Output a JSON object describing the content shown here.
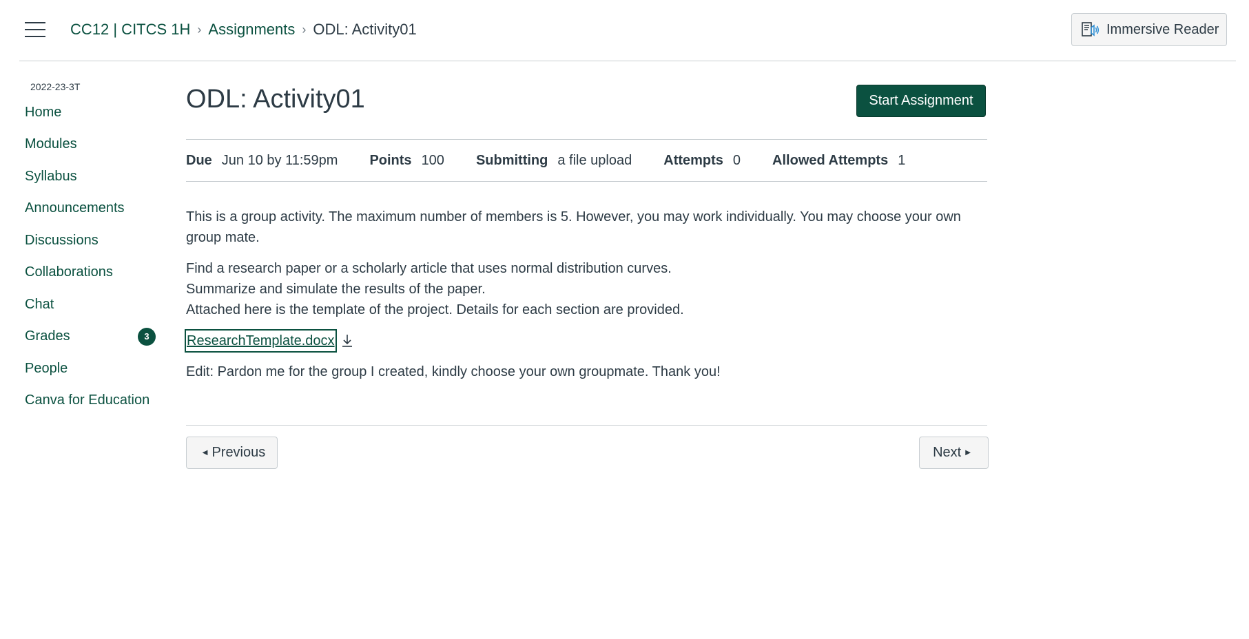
{
  "header": {
    "breadcrumb": [
      {
        "label": "CC12 | CITCS 1H"
      },
      {
        "label": "Assignments"
      },
      {
        "label": "ODL: Activity01"
      }
    ],
    "breadcrumb_separator": "›",
    "immersive_reader_label": "Immersive Reader"
  },
  "sidebar": {
    "term": "2022-23-3T",
    "items": [
      {
        "label": "Home"
      },
      {
        "label": "Modules"
      },
      {
        "label": "Syllabus"
      },
      {
        "label": "Announcements"
      },
      {
        "label": "Discussions"
      },
      {
        "label": "Collaborations"
      },
      {
        "label": "Chat"
      },
      {
        "label": "Grades",
        "badge": "3"
      },
      {
        "label": "People"
      },
      {
        "label": "Canva for Education"
      }
    ]
  },
  "assignment": {
    "title": "ODL: Activity01",
    "start_button": "Start Assignment",
    "details": {
      "due_label": "Due",
      "due_value": "Jun 10 by 11:59pm",
      "points_label": "Points",
      "points_value": "100",
      "submitting_label": "Submitting",
      "submitting_value": "a file upload",
      "attempts_label": "Attempts",
      "attempts_value": "0",
      "allowed_label": "Allowed Attempts",
      "allowed_value": "1"
    },
    "paragraph1": "This is a group activity. The maximum number of members is 5. However, you may work individually. You may choose your own group mate.",
    "paragraph2_lines": [
      "Find a research paper or a scholarly article that uses normal distribution curves.",
      "Summarize and simulate the results of the paper.",
      "Attached here is the template of the project. Details for each section are provided."
    ],
    "file_name": "ResearchTemplate.docx",
    "edit_note": "Edit: Pardon me for the group I created, kindly choose your own groupmate. Thank you!"
  },
  "pager": {
    "previous_label": "Previous",
    "next_label": "Next"
  },
  "colors": {
    "brand": "#0b5140",
    "text": "#2d3b45",
    "border": "#c7cdd1"
  }
}
